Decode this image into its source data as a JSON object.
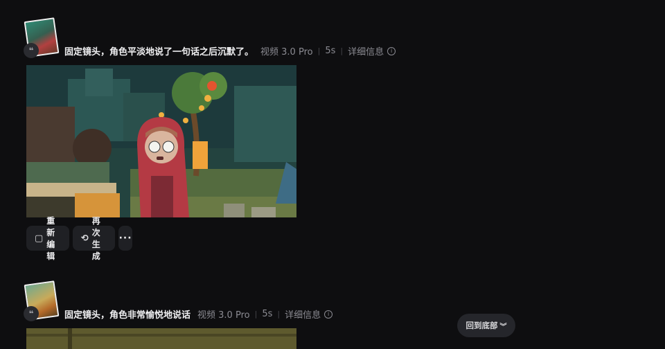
{
  "items": [
    {
      "prompt": "固定镜头，角色平淡地说了一句话之后沉默了。",
      "model": "视频 3.0 Pro",
      "duration": "5s",
      "details_label": "详细信息",
      "quote_icon": "quote-icon",
      "actions": {
        "reedit_label": "重新编辑",
        "regenerate_label": "再次生成",
        "more_label": "···"
      }
    },
    {
      "prompt": "固定镜头，角色非常愉悦地说话",
      "model": "视频 3.0 Pro",
      "duration": "5s",
      "details_label": "详细信息",
      "quote_icon": "quote-icon"
    }
  ],
  "back_to_bottom": {
    "label": "回到底部",
    "icon": "chevron-double-down-icon"
  },
  "colors": {
    "background": "#0e0e10",
    "button_bg": "#1f2024",
    "meta_text": "#8b8b92"
  }
}
